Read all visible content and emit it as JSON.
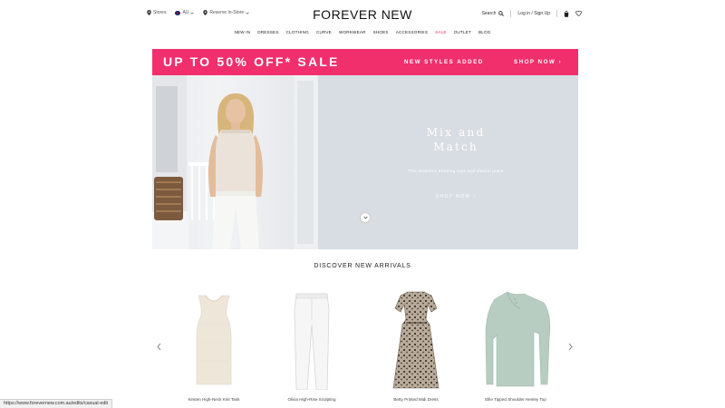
{
  "utility": {
    "stores_label": "Stores",
    "country_code": "AU",
    "click_collect_label": "Reserve In-Store",
    "search_label": "Search",
    "account_label": "Log in / Sign Up"
  },
  "logo": "FOREVER NEW",
  "nav": {
    "items": [
      "NEW IN",
      "DRESSES",
      "CLOTHING",
      "CURVE",
      "WORKWEAR",
      "SHOES",
      "ACCESSORIES",
      "SALE",
      "OUTLET",
      "BLOG"
    ],
    "sale_color": "#e8245f"
  },
  "sale_banner": {
    "title": "UP TO 50% OFF* SALE",
    "subtitle": "NEW STYLES ADDED",
    "cta": "SHOP NOW",
    "background": "#f12f6c"
  },
  "hero": {
    "heading": "Mix and Match",
    "copy": "This season's trending tops and classic jeans",
    "cta": "SHOP NOW",
    "background": "#d8dde3"
  },
  "arrivals": {
    "title": "DISCOVER NEW ARRIVALS",
    "products": [
      {
        "name": "Kirsten High-Neck Knit Tank",
        "color": "#efe6da"
      },
      {
        "name": "Olivia High-Rise Sculpting",
        "color": "#f4f4f4"
      },
      {
        "name": "Betty Printed Midi Dress",
        "color": "#8a7e72"
      },
      {
        "name": "Ellie Tipped Shoulder Henley Top",
        "color": "#b8cdc2"
      }
    ]
  },
  "status_bar": {
    "url": "https://www.forevernew.com.au/edits/casual-edit"
  },
  "icons": {
    "stores": "location-pin-icon",
    "flag": "australia-flag-icon",
    "search": "search-icon",
    "bag": "shopping-bag-icon",
    "wishlist": "heart-icon",
    "prev": "chevron-left-icon",
    "next": "chevron-right-icon",
    "scroll": "chevron-down-icon"
  }
}
